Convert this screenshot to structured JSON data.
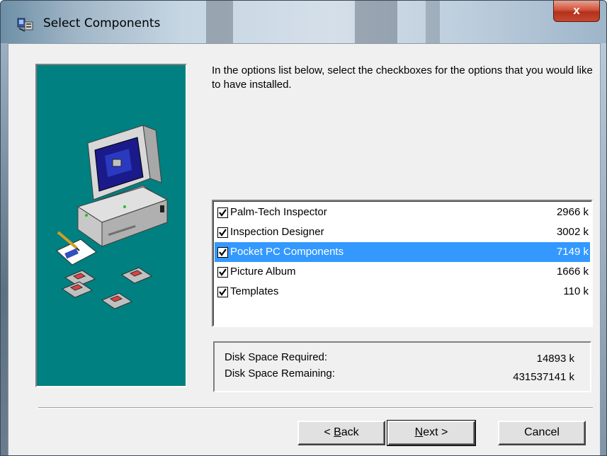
{
  "window": {
    "title": "Select Components",
    "close_label": "x",
    "icon": "installer-icon"
  },
  "instructions": "In the options list below, select the checkboxes for the options that you would like to have installed.",
  "components": [
    {
      "name": "Palm-Tech Inspector",
      "size": "2966 k",
      "checked": true,
      "selected": false
    },
    {
      "name": "Inspection Designer",
      "size": "3002 k",
      "checked": true,
      "selected": false
    },
    {
      "name": "Pocket PC Components",
      "size": "7149 k",
      "checked": true,
      "selected": true
    },
    {
      "name": "Picture Album",
      "size": "1666 k",
      "checked": true,
      "selected": false
    },
    {
      "name": "Templates",
      "size": "110 k",
      "checked": true,
      "selected": false
    }
  ],
  "disk_space": {
    "required_label": "Disk Space Required:",
    "required_value": "14893 k",
    "remaining_label": "Disk Space Remaining:",
    "remaining_value": "431537141 k"
  },
  "buttons": {
    "back_prefix": "< ",
    "back_access": "B",
    "back_rest": "ack",
    "next_access": "N",
    "next_rest": "ext >",
    "cancel": "Cancel"
  },
  "colors": {
    "panel_teal": "#008080",
    "selection": "#3399ff"
  }
}
